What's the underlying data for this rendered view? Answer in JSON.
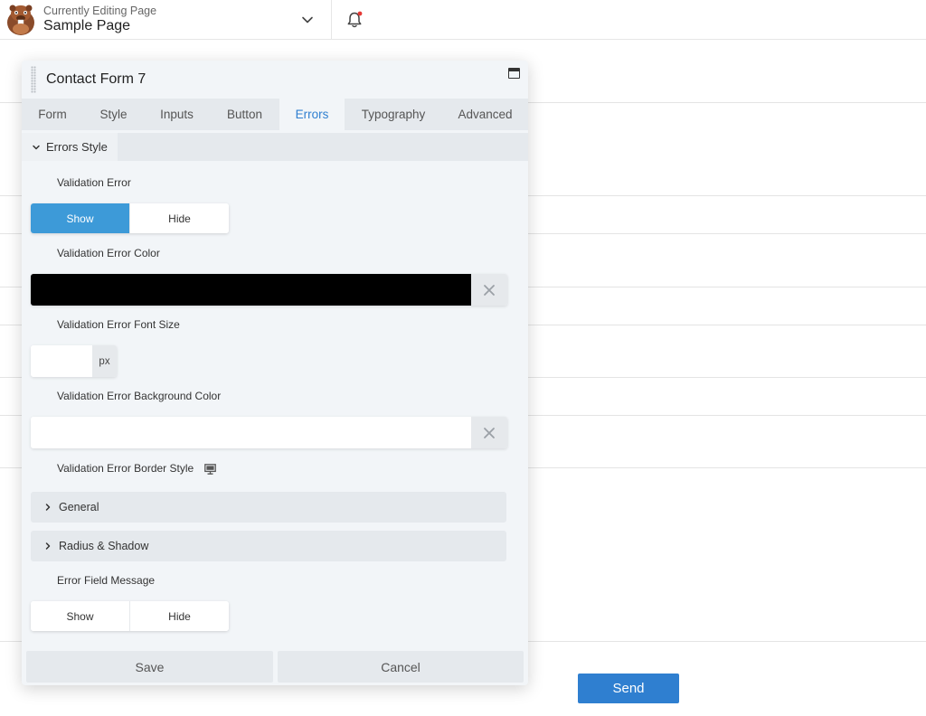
{
  "topbar": {
    "subtitle": "Currently Editing Page",
    "title": "Sample Page"
  },
  "page": {
    "send_label": "Send"
  },
  "panel": {
    "title": "Contact Form 7",
    "tabs": [
      {
        "label": "Form"
      },
      {
        "label": "Style"
      },
      {
        "label": "Inputs"
      },
      {
        "label": "Button"
      },
      {
        "label": "Errors",
        "active": true
      },
      {
        "label": "Typography"
      },
      {
        "label": "Advanced"
      }
    ],
    "section": {
      "label": "Errors Style"
    },
    "fields": {
      "validation_error": {
        "label": "Validation Error",
        "show": "Show",
        "hide": "Hide",
        "selected": "Show"
      },
      "validation_error_color": {
        "label": "Validation Error Color",
        "value": "#000000"
      },
      "validation_error_font_size": {
        "label": "Validation Error Font Size",
        "value": "",
        "unit": "px"
      },
      "validation_error_bg_color": {
        "label": "Validation Error Background Color",
        "value": "#ffffff"
      },
      "validation_error_border_style": {
        "label": "Validation Error Border Style"
      },
      "general": {
        "label": "General"
      },
      "radius_shadow": {
        "label": "Radius & Shadow"
      },
      "error_field_message": {
        "label": "Error Field Message",
        "show": "Show",
        "hide": "Hide",
        "selected": ""
      }
    },
    "footer": {
      "save": "Save",
      "cancel": "Cancel"
    }
  },
  "colors": {
    "accent": "#3d9ad8",
    "send_button": "#2f7fd0",
    "panel_bg": "#f2f5f8",
    "tab_bg": "#e5e9ed",
    "notification_dot": "#e53935"
  }
}
